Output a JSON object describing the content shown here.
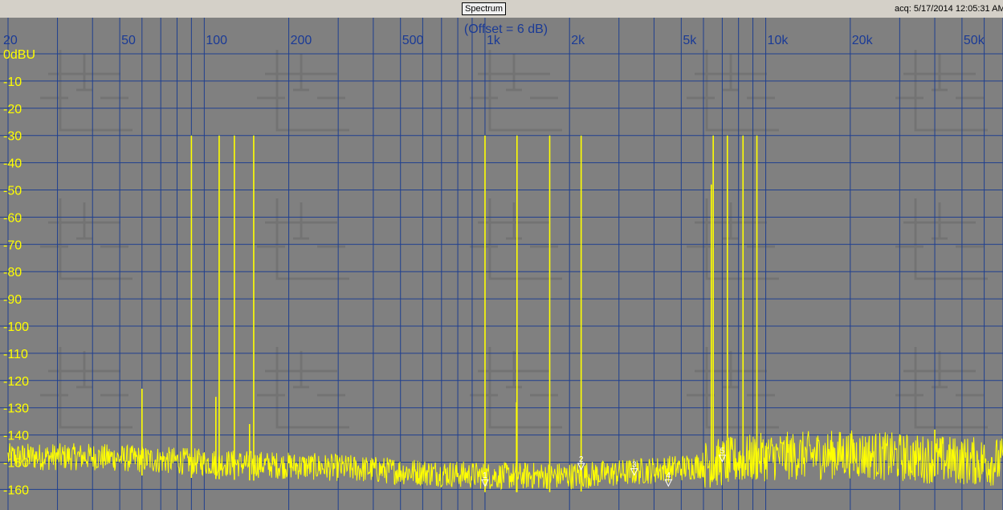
{
  "window": {
    "title": "Spectrum",
    "acq_label": "acq: 5/17/2014 12:05:31 AM"
  },
  "colors": {
    "plot_bg": "#808080",
    "grid": "#1f3f8f",
    "trace": "#ffff00",
    "x_label": "#1a3a96",
    "y_label": "#ffff00",
    "marker": "#ffffff"
  },
  "chart_data": {
    "type": "line",
    "title": "(Offset = 6 dB)",
    "xlabel": "",
    "ylabel": "",
    "x_scale": "log",
    "xlim": [
      20,
      70000
    ],
    "ylim": [
      -167,
      5
    ],
    "grid": true,
    "x_tick_labels": [
      {
        "value": 20,
        "label": "20"
      },
      {
        "value": 50,
        "label": "50"
      },
      {
        "value": 100,
        "label": "100"
      },
      {
        "value": 200,
        "label": "200"
      },
      {
        "value": 500,
        "label": "500"
      },
      {
        "value": 1000,
        "label": "1k"
      },
      {
        "value": 2000,
        "label": "2k"
      },
      {
        "value": 5000,
        "label": "5k"
      },
      {
        "value": 10000,
        "label": "10k"
      },
      {
        "value": 20000,
        "label": "20k"
      },
      {
        "value": 50000,
        "label": "50k"
      }
    ],
    "y_tick_labels": [
      {
        "value": 0,
        "label": "0dBU"
      },
      {
        "value": -10,
        "label": "-10"
      },
      {
        "value": -20,
        "label": "-20"
      },
      {
        "value": -30,
        "label": "-30"
      },
      {
        "value": -40,
        "label": "-40"
      },
      {
        "value": -50,
        "label": "-50"
      },
      {
        "value": -60,
        "label": "-60"
      },
      {
        "value": -70,
        "label": "-70"
      },
      {
        "value": -80,
        "label": "-80"
      },
      {
        "value": -90,
        "label": "-90"
      },
      {
        "value": -100,
        "label": "-100"
      },
      {
        "value": -110,
        "label": "-110"
      },
      {
        "value": -120,
        "label": "-120"
      },
      {
        "value": -130,
        "label": "-130"
      },
      {
        "value": -140,
        "label": "-140"
      },
      {
        "value": -150,
        "label": "-150"
      },
      {
        "value": -160,
        "label": "-160"
      }
    ],
    "noise_floor": [
      {
        "f": 20,
        "db": -148
      },
      {
        "f": 40,
        "db": -148
      },
      {
        "f": 100,
        "db": -150
      },
      {
        "f": 300,
        "db": -152
      },
      {
        "f": 1000,
        "db": -155
      },
      {
        "f": 2000,
        "db": -155
      },
      {
        "f": 3000,
        "db": -154
      },
      {
        "f": 5000,
        "db": -152
      },
      {
        "f": 7000,
        "db": -150
      },
      {
        "f": 10000,
        "db": -148
      },
      {
        "f": 20000,
        "db": -147
      },
      {
        "f": 40000,
        "db": -149
      },
      {
        "f": 70000,
        "db": -150
      }
    ],
    "series": [
      {
        "peaks": [
          {
            "f": 60,
            "db": -123
          },
          {
            "f": 90,
            "db": -30
          },
          {
            "f": 110,
            "db": -126
          },
          {
            "f": 113,
            "db": -30
          },
          {
            "f": 128,
            "db": -30
          },
          {
            "f": 145,
            "db": -136
          },
          {
            "f": 150,
            "db": -30
          },
          {
            "f": 1000,
            "db": -30
          },
          {
            "f": 1295,
            "db": -128
          },
          {
            "f": 1300,
            "db": -30
          },
          {
            "f": 1700,
            "db": -30
          },
          {
            "f": 2200,
            "db": -30
          },
          {
            "f": 6400,
            "db": -48
          },
          {
            "f": 6500,
            "db": -30
          },
          {
            "f": 7300,
            "db": -30
          },
          {
            "f": 8300,
            "db": -30
          },
          {
            "f": 9300,
            "db": -30
          },
          {
            "f": 40000,
            "db": -138
          }
        ]
      }
    ],
    "markers": [
      {
        "label": "1",
        "f": 1000,
        "db": -157
      },
      {
        "label": "2",
        "f": 2200,
        "db": -151
      },
      {
        "label": "3",
        "f": 3400,
        "db": -153
      },
      {
        "label": "4",
        "f": 4500,
        "db": -157
      },
      {
        "label": "5",
        "f": 7000,
        "db": -148
      }
    ]
  }
}
